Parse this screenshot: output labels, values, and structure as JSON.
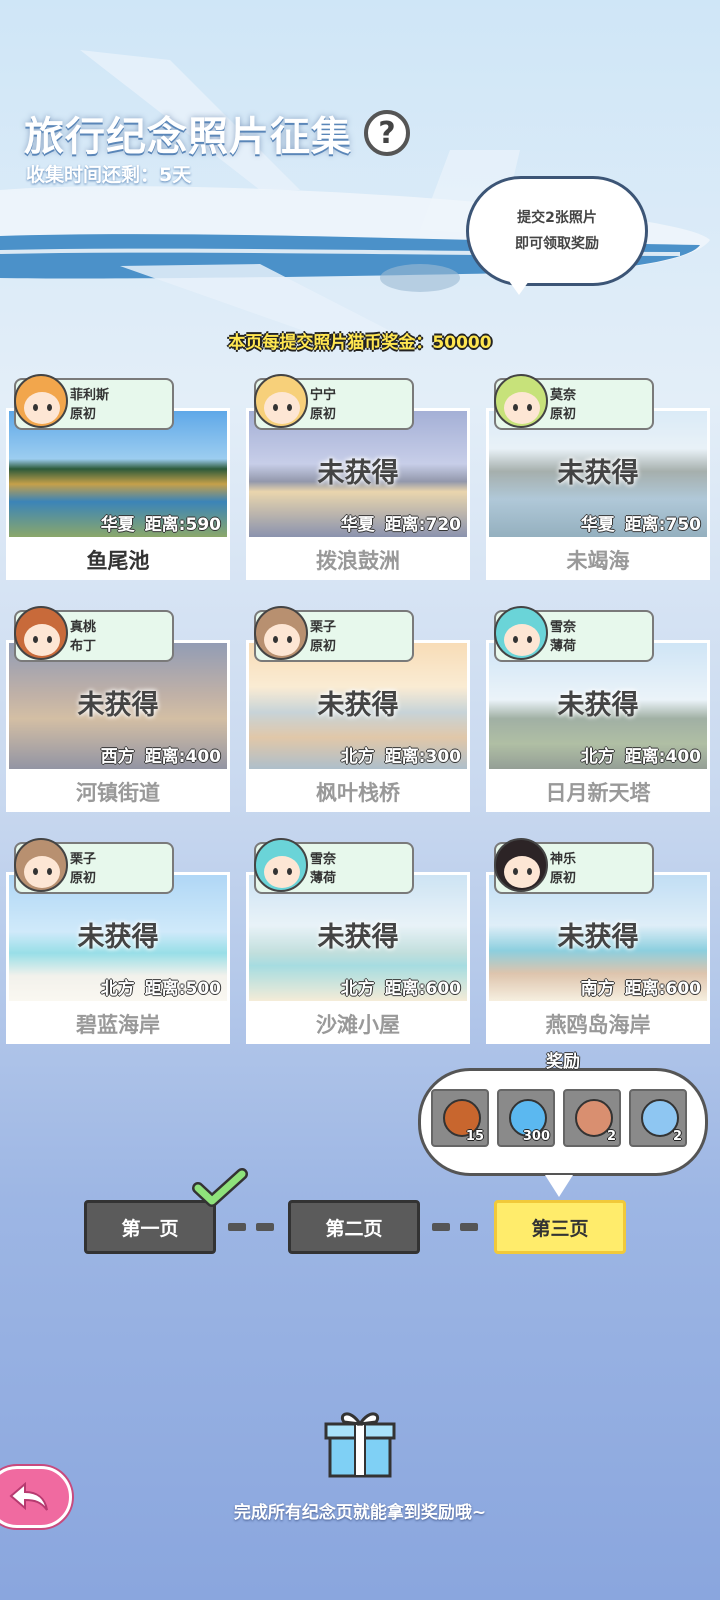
{
  "header": {
    "title": "旅行纪念照片征集",
    "help_icon": "?",
    "time_left": "收集时间还剩：5天",
    "bubble_line1": "提交2张照片",
    "bubble_line2": "即可领取奖励",
    "bonus": "本页每提交照片猫币奖金：50000"
  },
  "locked_label": "未获得",
  "distance_label": "距离:",
  "cards": [
    {
      "char1": "菲利斯",
      "char2": "原初",
      "region": "华夏",
      "distance": "590",
      "name": "鱼尾池",
      "obtained": true,
      "scene": "lake"
    },
    {
      "char1": "宁宁",
      "char2": "原初",
      "region": "华夏",
      "distance": "720",
      "name": "拨浪鼓洲",
      "obtained": false,
      "scene": "city"
    },
    {
      "char1": "莫奈",
      "char2": "原初",
      "region": "华夏",
      "distance": "750",
      "name": "未竭海",
      "obtained": false,
      "scene": "coast"
    },
    {
      "char1": "真桃",
      "char2": "布丁",
      "region": "西方",
      "distance": "400",
      "name": "河镇街道",
      "obtained": false,
      "scene": "street"
    },
    {
      "char1": "栗子",
      "char2": "原初",
      "region": "北方",
      "distance": "300",
      "name": "枫叶栈桥",
      "obtained": false,
      "scene": "bridge"
    },
    {
      "char1": "雪奈",
      "char2": "薄荷",
      "region": "北方",
      "distance": "400",
      "name": "日月新天塔",
      "obtained": false,
      "scene": "hill"
    },
    {
      "char1": "栗子",
      "char2": "原初",
      "region": "北方",
      "distance": "500",
      "name": "碧蓝海岸",
      "obtained": false,
      "scene": "beach"
    },
    {
      "char1": "雪奈",
      "char2": "薄荷",
      "region": "北方",
      "distance": "600",
      "name": "沙滩小屋",
      "obtained": false,
      "scene": "hut"
    },
    {
      "char1": "神乐",
      "char2": "原初",
      "region": "南方",
      "distance": "600",
      "name": "燕鸥岛海岸",
      "obtained": false,
      "scene": "rocks"
    }
  ],
  "reward": {
    "title": "奖励",
    "items": [
      {
        "icon": "roast-food-icon",
        "count": "15",
        "color": "#c8662e"
      },
      {
        "icon": "blue-fish-icon",
        "count": "300",
        "color": "#5bb8f0"
      },
      {
        "icon": "dish-icon",
        "count": "2",
        "color": "#d98f70"
      },
      {
        "icon": "crystal-icon",
        "count": "2",
        "color": "#8ec6f2"
      }
    ]
  },
  "pages": {
    "page1": "第一页",
    "page2": "第二页",
    "page3": "第三页"
  },
  "footer": {
    "finish_text": "完成所有纪念页就能拿到奖励哦~"
  }
}
